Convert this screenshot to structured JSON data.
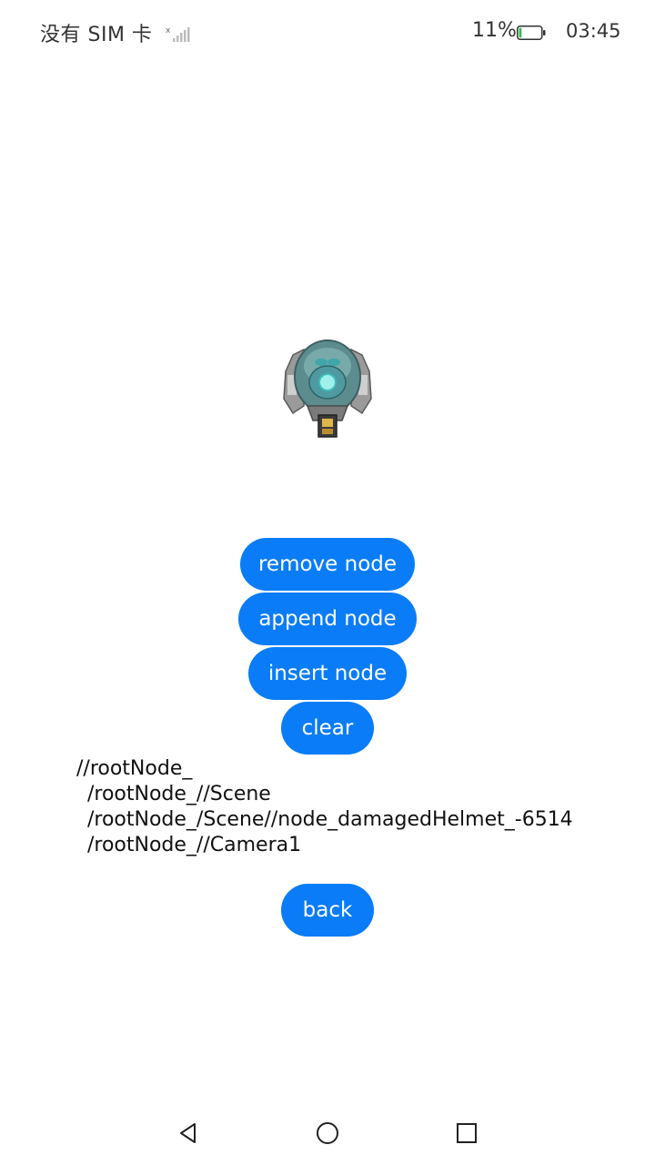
{
  "status_bar": {
    "carrier": "没有 SIM 卡",
    "battery_percent": "11%",
    "battery_level": 0.11,
    "time": "03:45",
    "icons": [
      "signal-icon",
      "battery-icon"
    ]
  },
  "scene": {
    "model_icon": "helmet-model"
  },
  "actions": {
    "remove_label": "remove node",
    "append_label": "append node",
    "insert_label": "insert node",
    "clear_label": "clear",
    "back_label": "back"
  },
  "node_tree": {
    "lines": [
      "//rootNode_",
      "/rootNode_//Scene",
      "/rootNode_/Scene//node_damagedHelmet_-6514",
      "/rootNode_//Camera1"
    ]
  },
  "nav_bar": {
    "icons": [
      "back-triangle-icon",
      "home-circle-icon",
      "recents-square-icon"
    ]
  },
  "colors": {
    "accent": "#0a7cf7",
    "battery_low": "#2fbf4f"
  }
}
